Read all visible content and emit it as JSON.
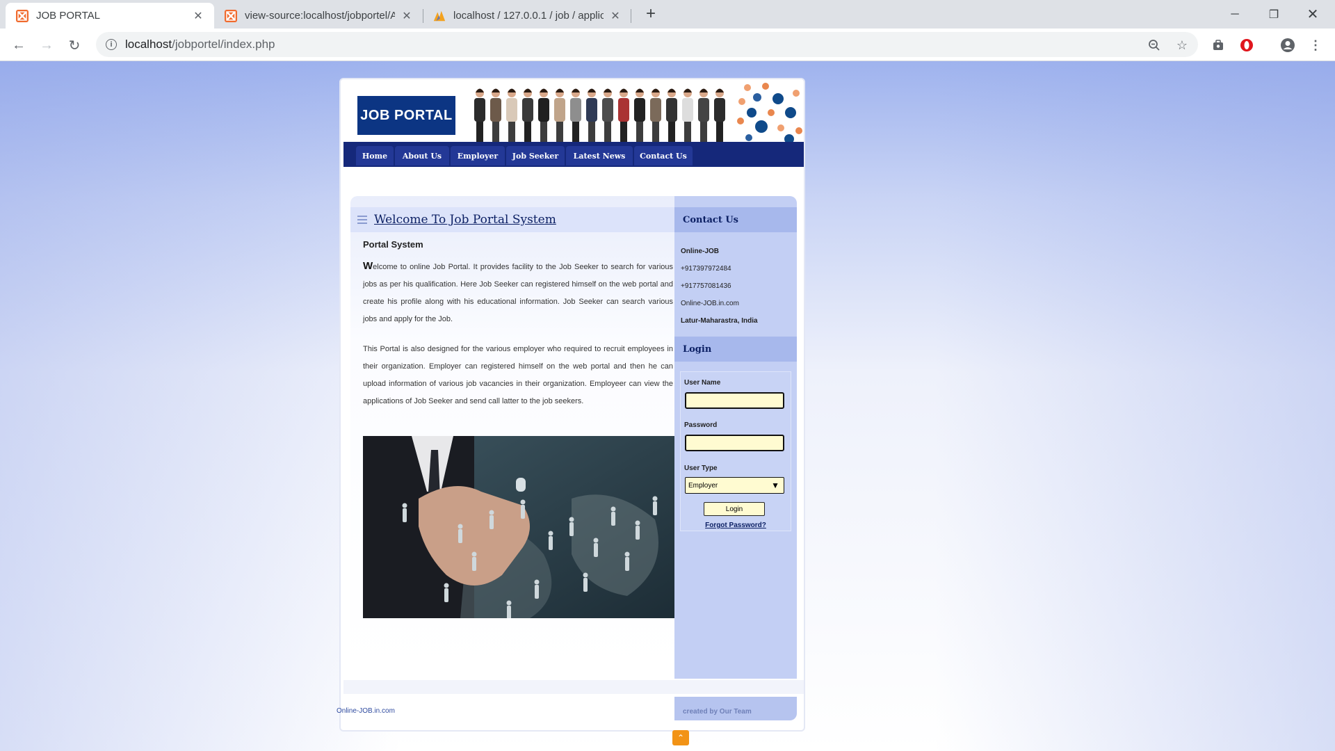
{
  "browser": {
    "tabs": [
      {
        "title": "JOB PORTAL",
        "active": true
      },
      {
        "title": "view-source:localhost/jobportel/A",
        "active": false
      },
      {
        "title": "localhost / 127.0.0.1 / job / applic",
        "active": false
      }
    ],
    "address": {
      "host": "localhost",
      "path": "/jobportel/index.php"
    }
  },
  "site": {
    "logo": "JOB PORTAL",
    "menu": [
      "Home",
      "About Us",
      "Employer",
      "Job Seeker",
      "Latest News",
      "Contact Us"
    ],
    "main": {
      "title": "Welcome To Job Portal System",
      "subtitle": "Portal System",
      "para1_cap": "W",
      "para1": "elcome to online Job Portal. It provides facility to the Job Seeker to search for various jobs as per his qualification. Here Job Seeker can registered himself on the web portal and create his profile along with his educational information. Job Seeker can search various jobs and apply for the Job.",
      "para2": "This Portal is also designed for the various employer who required to recruit employees in their organization. Employer can registered himself on the web portal and then he can upload information of various job vacancies in their organization. Employeer can view the applications of Job Seeker and send call latter to the job seekers."
    },
    "contact": {
      "heading": "Contact Us",
      "name": "Online-JOB",
      "phone1": "+917397972484",
      "phone2": "+917757081436",
      "website": "Online-JOB.in.com",
      "location": "Latur-Maharastra, India"
    },
    "login": {
      "heading": "Login",
      "username_label": "User Name",
      "password_label": "Password",
      "usertype_label": "User Type",
      "usertype_value": "Employer",
      "button": "Login",
      "forgot": "Forgot Password?"
    },
    "footer": {
      "left": "Online-JOB.in.com",
      "right": "created by Our Team"
    }
  },
  "colors": {
    "navy": "#0c3583",
    "menu_bg": "#15287a",
    "sidebar": "#c3cff4",
    "input_bg": "#fffbd1",
    "scroll_top": "#f29316"
  }
}
